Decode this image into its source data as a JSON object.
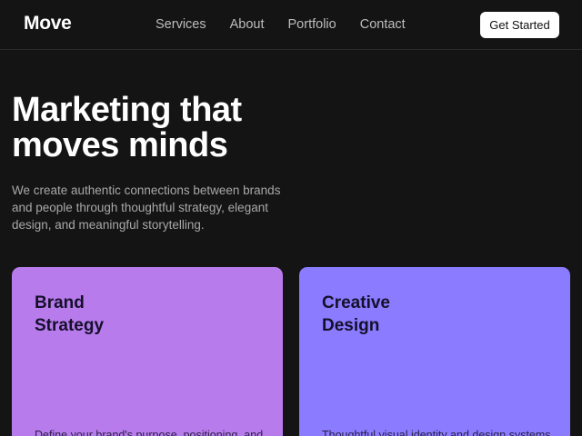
{
  "header": {
    "logo": "Move",
    "nav": [
      "Services",
      "About",
      "Portfolio",
      "Contact"
    ],
    "cta_label": "Get Started"
  },
  "hero": {
    "title_line1": "Marketing that",
    "title_line2": "moves minds",
    "description": "We create authentic connections between brands and people through thoughtful strategy, elegant design, and meaningful storytelling."
  },
  "cards": [
    {
      "title_line1": "Brand",
      "title_line2": "Strategy",
      "text": "Define your brand's purpose, positioning, and",
      "color": "#b87bec"
    },
    {
      "title_line1": "Creative",
      "title_line2": "Design",
      "text": "Thoughtful visual identity and design systems",
      "color": "#8a7bff"
    }
  ],
  "colors": {
    "background": "#141414",
    "text": "#ffffff",
    "muted_text": "#a8a8a8"
  }
}
